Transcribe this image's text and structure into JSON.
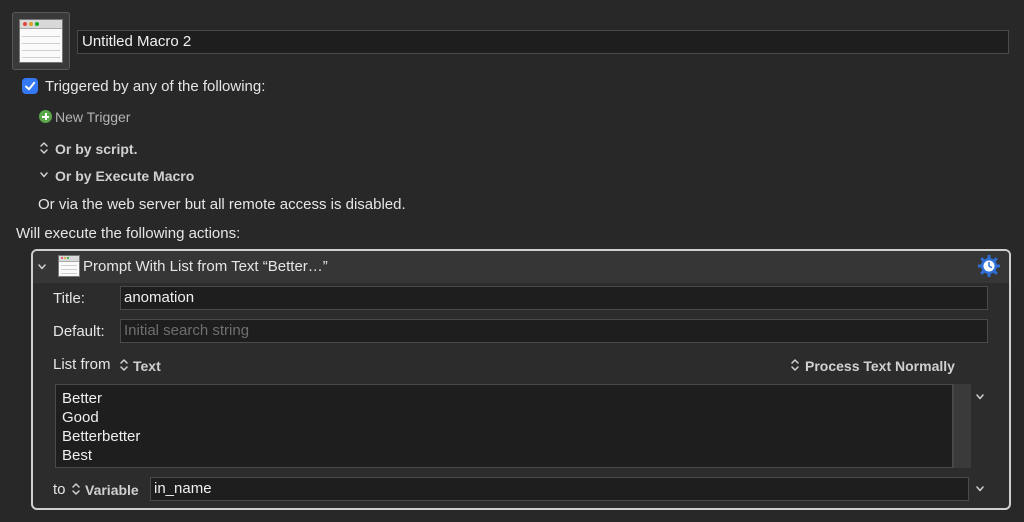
{
  "macro": {
    "name": "Untitled Macro 2"
  },
  "triggers": {
    "enabled": true,
    "heading": "Triggered by any of the following:",
    "new_trigger_label": "New Trigger",
    "by_script_label": "Or by script.",
    "by_execute_macro_label": "Or by Execute Macro",
    "web_server_note": "Or via the web server but all remote access is disabled."
  },
  "actions": {
    "heading": "Will execute the following actions:",
    "items": [
      {
        "title": "Prompt With List from Text “Better…”",
        "fields": {
          "title_label": "Title:",
          "title_value": "anomation",
          "default_label": "Default:",
          "default_value": "",
          "default_placeholder": "Initial search string",
          "list_from_label": "List from",
          "list_source": "Text",
          "process_mode": "Process Text Normally",
          "list_lines": [
            "Better",
            "Good",
            "Betterbetter",
            "Best"
          ],
          "to_label": "to",
          "to_type": "Variable",
          "variable_name": "in_name"
        }
      }
    ]
  },
  "colors": {
    "background": "#282828",
    "accent": "#3478f6",
    "add_green": "#5aa84a",
    "gear_blue": "#2f6fd6"
  },
  "icons": [
    "macro-window-icon",
    "checkbox-icon",
    "plus-circle-icon",
    "updown-chevron-icon",
    "chevron-down-icon",
    "action-window-icon",
    "gear-clock-icon"
  ]
}
